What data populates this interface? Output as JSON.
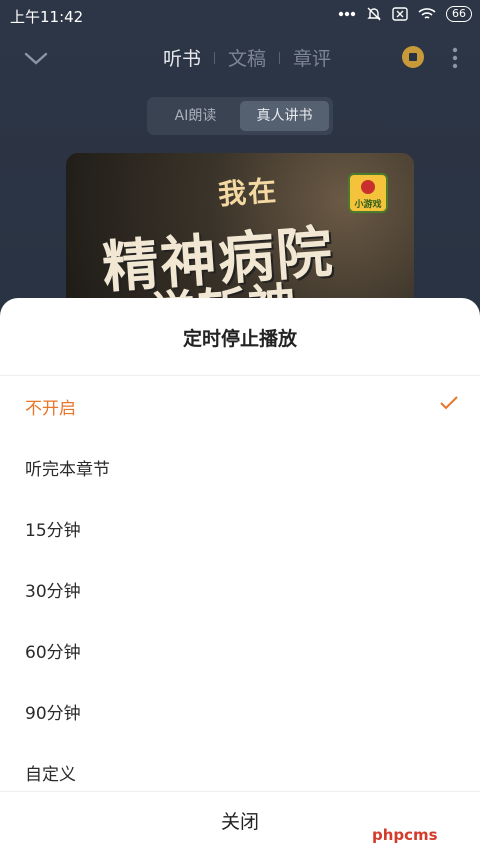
{
  "status_bar": {
    "time": "上午11:42",
    "battery": "66"
  },
  "topnav": {
    "tabs": [
      {
        "label": "听书",
        "active": true
      },
      {
        "label": "文稿",
        "active": false
      },
      {
        "label": "章评",
        "active": false
      }
    ]
  },
  "mode_switch": {
    "options": [
      {
        "label": "AI朗读",
        "selected": false
      },
      {
        "label": "真人讲书",
        "selected": true
      }
    ]
  },
  "cover": {
    "line1": "我在",
    "line2": "精神病院",
    "line3": "学斩神",
    "badge": "小游戏"
  },
  "sheet": {
    "title": "定时停止播放",
    "options": [
      {
        "label": "不开启",
        "selected": true
      },
      {
        "label": "听完本章节",
        "selected": false
      },
      {
        "label": "15分钟",
        "selected": false
      },
      {
        "label": "30分钟",
        "selected": false
      },
      {
        "label": "60分钟",
        "selected": false
      },
      {
        "label": "90分钟",
        "selected": false
      },
      {
        "label": "自定义",
        "selected": false
      }
    ],
    "close_label": "关闭"
  },
  "watermark": "phpcms",
  "colors": {
    "accent": "#e8762b",
    "background": "#252d3c",
    "sheet": "#ffffff"
  }
}
